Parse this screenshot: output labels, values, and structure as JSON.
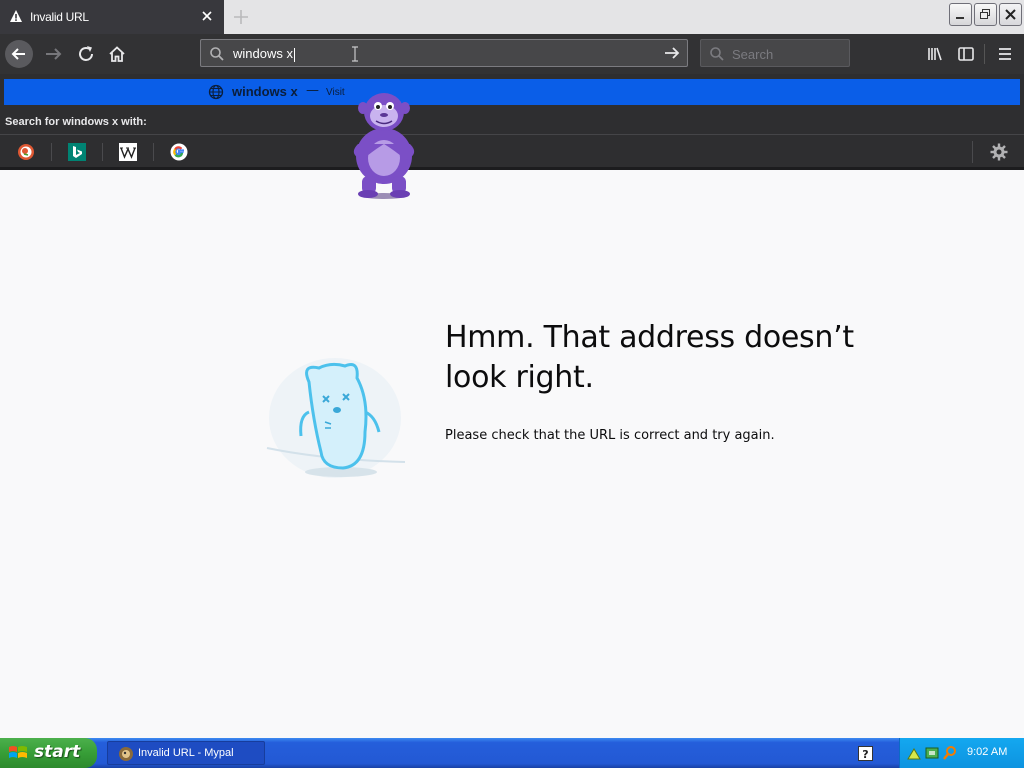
{
  "window": {
    "tab_title": "Invalid URL"
  },
  "navbar": {
    "url_value": "windows x",
    "search_placeholder": "Search"
  },
  "popup": {
    "row_text": "windows x",
    "row_sep": "—",
    "row_action": "Visit",
    "search_with": "Search for windows x with:",
    "engines": [
      "duckduckgo-icon",
      "bing-icon",
      "wikipedia-icon",
      "google-icon"
    ]
  },
  "page": {
    "title": "Hmm. That address doesn’t look right.",
    "description": "Please check that the URL is correct and try again."
  },
  "taskbar": {
    "start_label": "start",
    "task_label": "Invalid URL - Mypal",
    "clock": "9:02 AM"
  },
  "colors": {
    "accent": "#0a5ee8",
    "toolbar": "#323234",
    "page_bg": "#f9f9fa",
    "taskbar": "#245edb",
    "start_green": "#379e37"
  }
}
